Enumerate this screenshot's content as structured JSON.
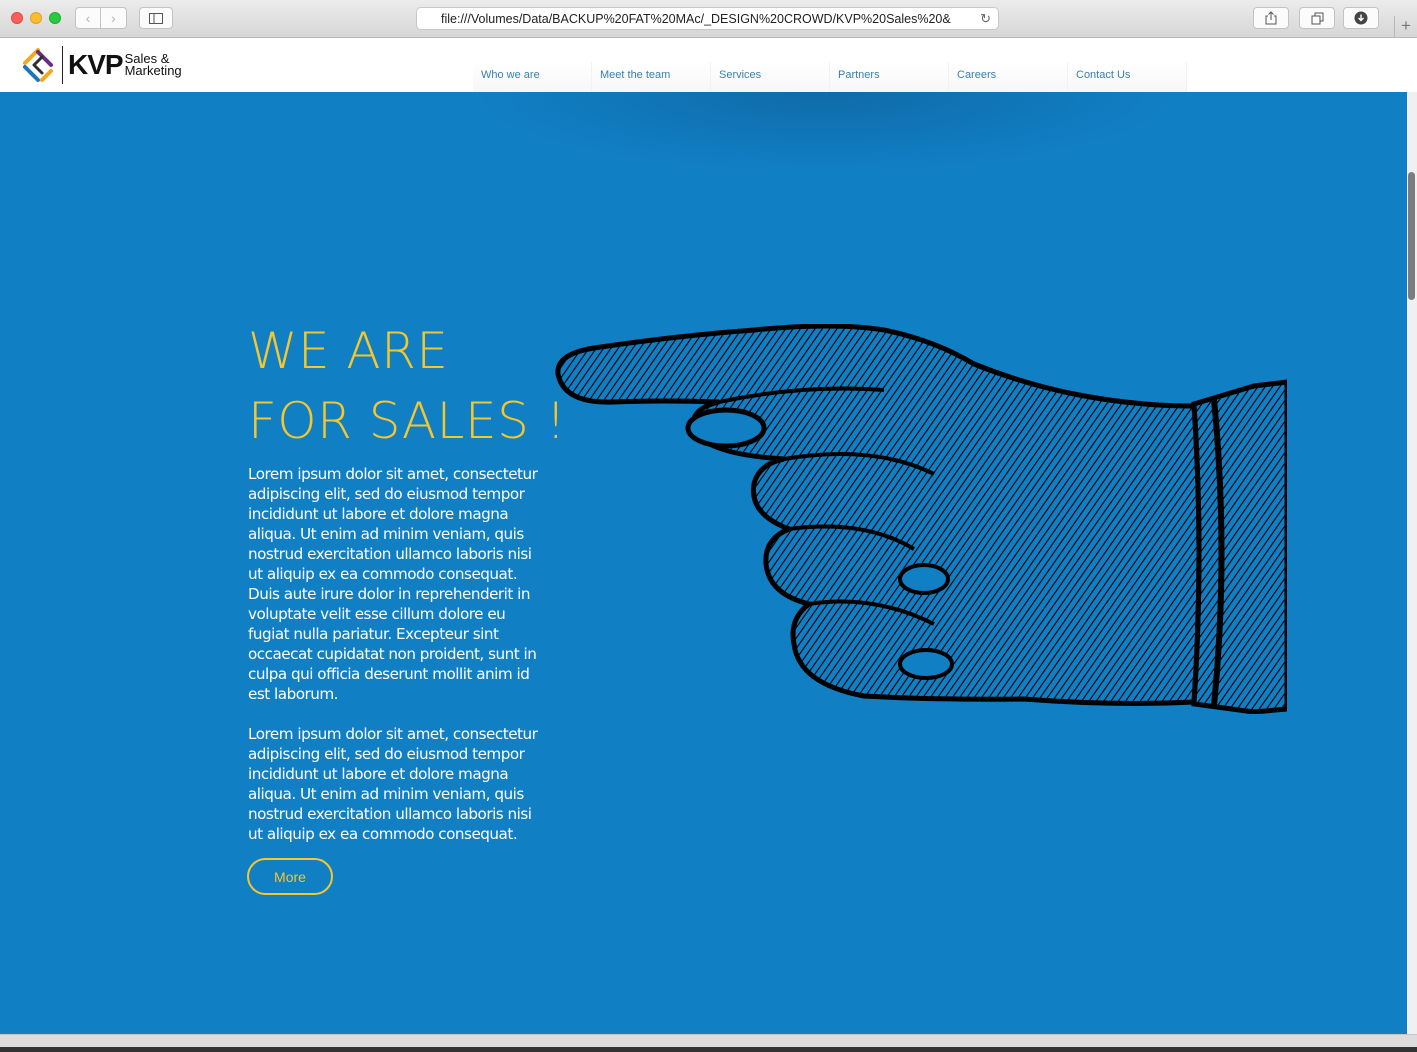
{
  "browser": {
    "url": "file:///Volumes/Data/BACKUP%20FAT%20MAc/_DESIGN%20CROWD/KVP%20Sales%20&",
    "icons": [
      "back-icon",
      "forward-icon",
      "sidebar-icon",
      "reload-icon",
      "share-icon",
      "tabs-icon",
      "download-icon",
      "new-tab-icon"
    ]
  },
  "site": {
    "logo": {
      "mark": "KVP",
      "line1": "Sales &",
      "line2": "Marketing"
    },
    "nav": [
      {
        "label": "Who we are"
      },
      {
        "label": "Meet the team"
      },
      {
        "label": "Services"
      },
      {
        "label": "Partners"
      },
      {
        "label": "Careers"
      },
      {
        "label": "Contact Us"
      }
    ]
  },
  "hero": {
    "headline_line1": "WE ARE",
    "headline_line2": "FOR SALES !",
    "paragraph1": "Lorem ipsum dolor sit amet, consectetur adipiscing elit, sed do eiusmod tempor incididunt ut labore et dolore magna aliqua. Ut enim ad minim veniam, quis nostrud exercitation ullamco laboris nisi ut aliquip ex ea commodo consequat. Duis aute irure dolor in reprehenderit in voluptate velit esse cillum dolore eu fugiat nulla pariatur. Excepteur sint occaecat cupidatat non proident, sunt in culpa qui officia deserunt mollit anim id est laborum.",
    "paragraph2": "Lorem ipsum dolor sit amet, consectetur adipiscing elit, sed do eiusmod tempor incididunt ut labore et dolore magna aliqua. Ut enim ad minim veniam, quis nostrud exercitation ullamco laboris nisi ut aliquip ex ea commodo consequat.",
    "more_label": "More",
    "image": "pointing-hand-illustration"
  },
  "colors": {
    "hero_bg": "#117fc4",
    "accent_yellow": "#f4c72e",
    "nav_text": "#3a7fae",
    "text_white": "#ffffff"
  }
}
